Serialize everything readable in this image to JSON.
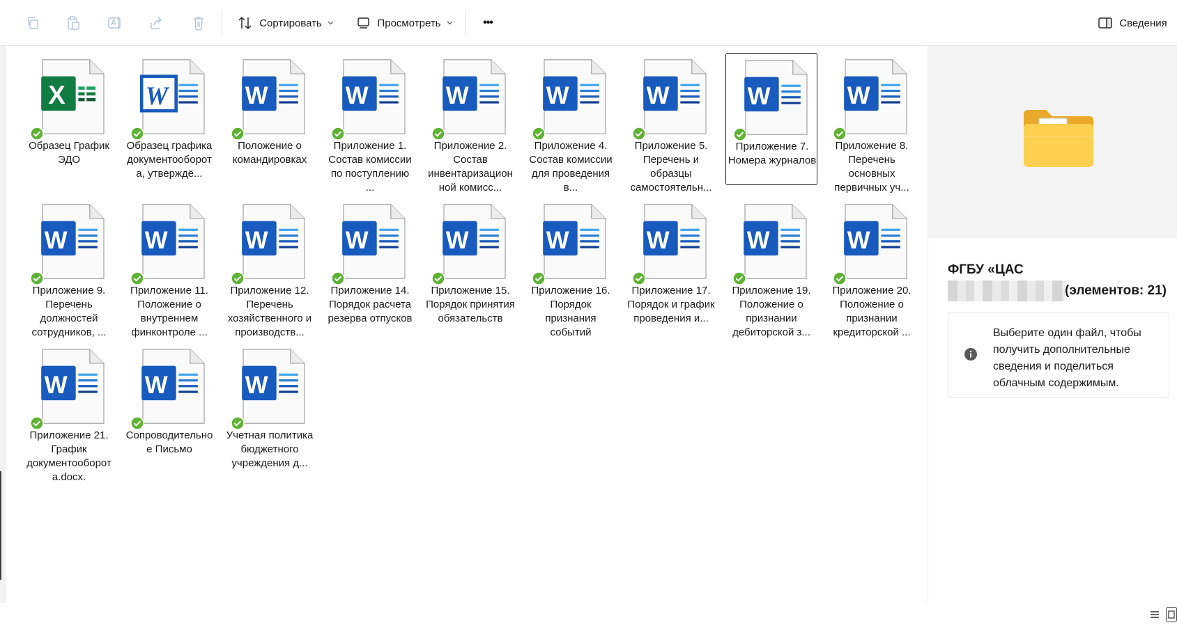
{
  "toolbar": {
    "copy_icon": "copy-icon",
    "paste_icon": "paste-icon",
    "rename_icon": "rename-icon",
    "share_icon": "share-icon",
    "delete_icon": "trash-icon",
    "sort_label": "Сортировать",
    "view_label": "Просмотреть",
    "more_label": "•••",
    "details_label": "Сведения"
  },
  "files": [
    {
      "name": "Образец График ЭДО",
      "type": "excel"
    },
    {
      "name": "Образец графика документооборота, утверждё...",
      "type": "word-legacy"
    },
    {
      "name": "Положение о командировках",
      "type": "word"
    },
    {
      "name": "Приложение 1. Состав комиссии по поступлению ...",
      "type": "word"
    },
    {
      "name": "Приложение 2. Состав инвентаризационной комисс...",
      "type": "word"
    },
    {
      "name": "Приложение 4. Состав комиссии для проведения в...",
      "type": "word"
    },
    {
      "name": "Приложение 5. Перечень и образцы самостоятельн...",
      "type": "word"
    },
    {
      "name": "Приложение 7. Номера журналов",
      "type": "word",
      "selected": true
    },
    {
      "name": "Приложение 8. Перечень основных первичных уч...",
      "type": "word"
    },
    {
      "name": "Приложение 9. Перечень должностей сотрудников, ...",
      "type": "word"
    },
    {
      "name": "Приложение 11. Положение о внутреннем финконтроле ...",
      "type": "word"
    },
    {
      "name": "Приложение 12. Перечень хозяйственного и производств...",
      "type": "word"
    },
    {
      "name": "Приложение 14. Порядок расчета резерва отпусков",
      "type": "word"
    },
    {
      "name": "Приложение 15. Порядок принятия обязательств",
      "type": "word"
    },
    {
      "name": "Приложение 16. Порядок признания событий",
      "type": "word"
    },
    {
      "name": "Приложение 17. Порядок и график проведения и...",
      "type": "word"
    },
    {
      "name": "Приложение 19. Положение о признании дебиторской з...",
      "type": "word"
    },
    {
      "name": "Приложение 20. Положение о признании кредиторской ...",
      "type": "word"
    },
    {
      "name": "Приложение 21. График документооборота.docx.",
      "type": "word"
    },
    {
      "name": "Сопроводительное Письмо",
      "type": "word"
    },
    {
      "name": "Учетная политика бюджетного учреждения д...",
      "type": "word"
    }
  ],
  "details": {
    "folder_title": "ФГБУ «ЦАС",
    "item_count": "(элементов: 21)",
    "info_text": "Выберите один файл, чтобы получить дополнительные сведения и поделиться облачным содержимым."
  },
  "colors": {
    "word_blue": "#185abd",
    "excel_green": "#107c41",
    "sync_green": "#5fb234",
    "folder_yellow": "#f8c640"
  }
}
